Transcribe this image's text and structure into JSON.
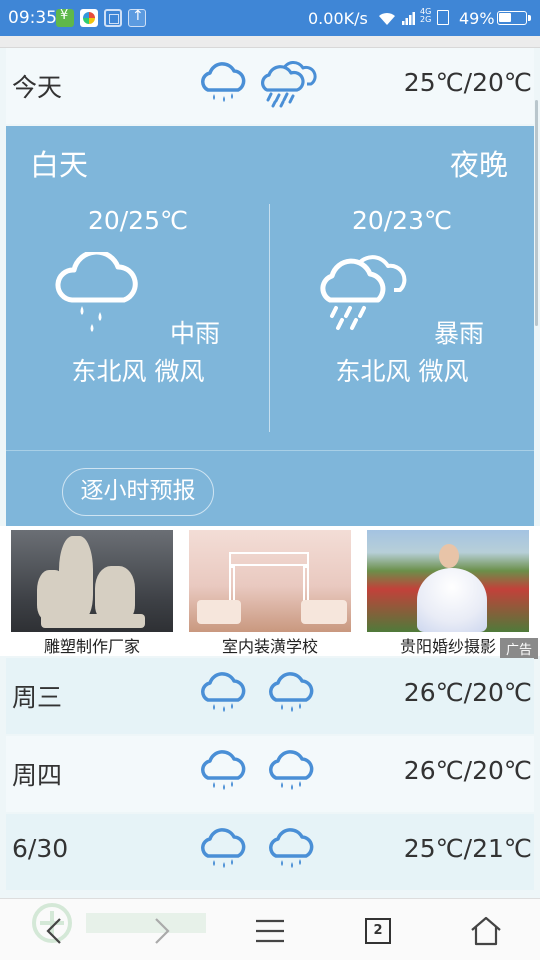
{
  "status_bar": {
    "time": "09:35",
    "network_speed": "0.00K/s",
    "signal_small_top": "4G",
    "signal_small_bottom": "2G",
    "battery_percent": "49%",
    "battery_level": 0.49,
    "notification_icons": [
      "payment-app-icon",
      "gallery-app-icon",
      "screenshot-icon",
      "upload-icon"
    ]
  },
  "today": {
    "label": "今天",
    "temp": "25℃/20℃",
    "icons": [
      "rain-icon",
      "heavy-rain-icon"
    ]
  },
  "detail": {
    "day_header": "白天",
    "night_header": "夜晚",
    "day": {
      "range": "20/25℃",
      "condition": "中雨",
      "wind": "东北风 微风",
      "icon": "rain-icon"
    },
    "night": {
      "range": "20/23℃",
      "condition": "暴雨",
      "wind": "东北风 微风",
      "icon": "heavy-rain-icon"
    },
    "hourly_button": "逐小时预报"
  },
  "ads": {
    "badge": "广告",
    "items": [
      {
        "caption": "雕塑制作厂家"
      },
      {
        "caption": "室内装潢学校"
      },
      {
        "caption": "贵阳婚纱摄影"
      }
    ]
  },
  "forecast": [
    {
      "label": "周三",
      "temp": "26℃/20℃",
      "icons": [
        "rain-icon",
        "rain-icon"
      ]
    },
    {
      "label": "周四",
      "temp": "26℃/20℃",
      "icons": [
        "rain-icon",
        "rain-icon"
      ]
    },
    {
      "label": "6/30",
      "temp": "25℃/21℃",
      "icons": [
        "rain-icon",
        "rain-icon"
      ]
    }
  ],
  "bottom_nav": {
    "tab_count": "2",
    "items": [
      "back-icon",
      "forward-icon",
      "menu-icon",
      "tabs-icon",
      "home-icon"
    ]
  },
  "colors": {
    "status_bar": "#3f86d6",
    "panel": "#7fb6da",
    "icon_blue": "#4a8fd6",
    "row_bg": "#eef6f8"
  }
}
